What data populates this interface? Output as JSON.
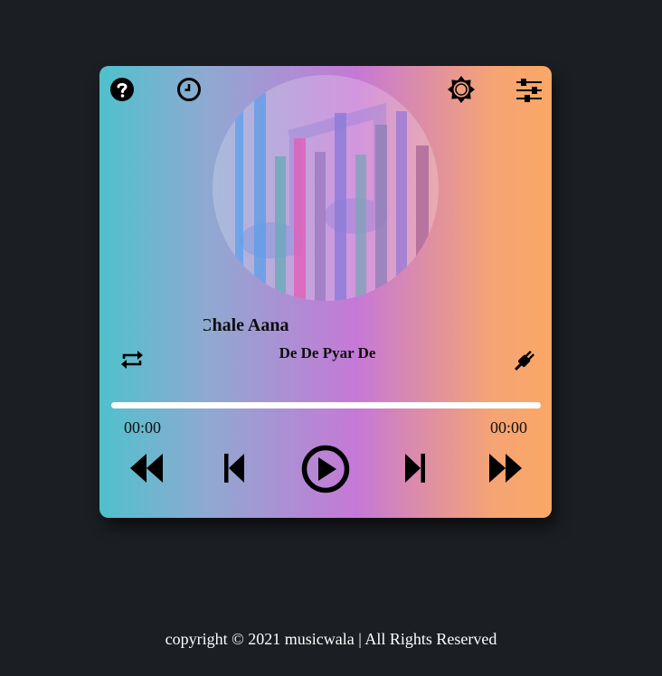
{
  "top_bar": {
    "help_icon": "question-circle-icon",
    "history_icon": "clock-icon",
    "theme_icon": "sun-icon",
    "settings_icon": "sliders-icon"
  },
  "track": {
    "title": "Chale Aana",
    "artist": "De De Pyar De",
    "current_time": "00:00",
    "duration": "00:00",
    "progress": 1.0
  },
  "controls": {
    "repeat_icon": "repeat-icon",
    "plug_icon": "plug-icon",
    "fast_rewind_icon": "fast-rewind-icon",
    "previous_icon": "skip-previous-icon",
    "play_icon": "play-circle-icon",
    "next_icon": "skip-next-icon",
    "fast_forward_icon": "fast-forward-icon"
  },
  "colors": {
    "background": "#1b1e23",
    "gradient_start": "#4fc1cc",
    "gradient_mid": "#c678d6",
    "gradient_end": "#fba766"
  },
  "footer": {
    "text": "copyright © 2021 musicwala | All Rights Reserved"
  }
}
